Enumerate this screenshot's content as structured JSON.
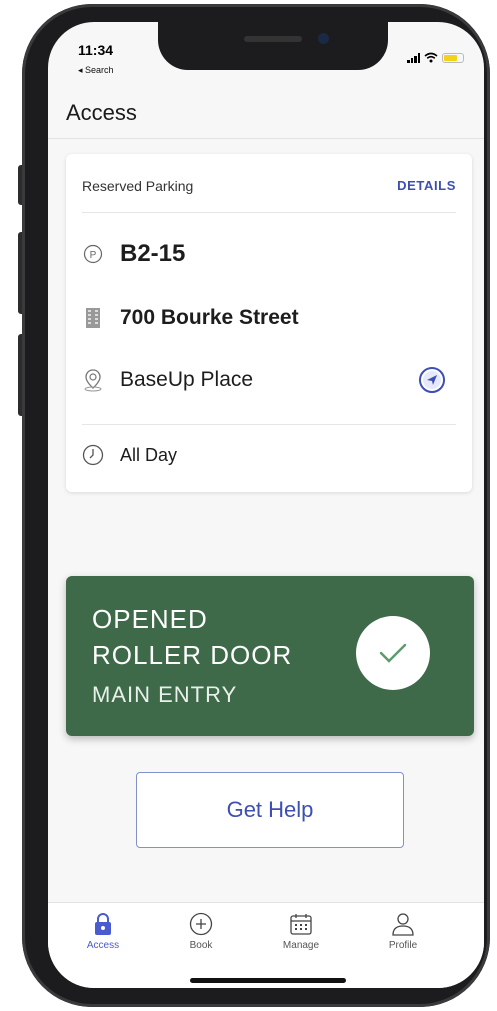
{
  "status_bar": {
    "time": "11:34",
    "back_label": "◂ Search"
  },
  "header": {
    "title": "Access"
  },
  "card": {
    "label": "Reserved Parking",
    "details_link": "DETAILS",
    "bay": "B2-15",
    "address": "700 Bourke Street",
    "place": "BaseUp Place",
    "duration": "All Day"
  },
  "status": {
    "line1": "OPENED",
    "line2": "ROLLER DOOR",
    "line3": "MAIN ENTRY",
    "color": "#3e6a49"
  },
  "help_button": {
    "label": "Get Help"
  },
  "tabs": [
    {
      "label": "Access",
      "icon": "lock-icon",
      "active": true
    },
    {
      "label": "Book",
      "icon": "plus-circle-icon",
      "active": false
    },
    {
      "label": "Manage",
      "icon": "calendar-icon",
      "active": false
    },
    {
      "label": "Profile",
      "icon": "person-icon",
      "active": false
    }
  ],
  "colors": {
    "accent": "#3d4fb4",
    "success": "#3e6a49"
  }
}
